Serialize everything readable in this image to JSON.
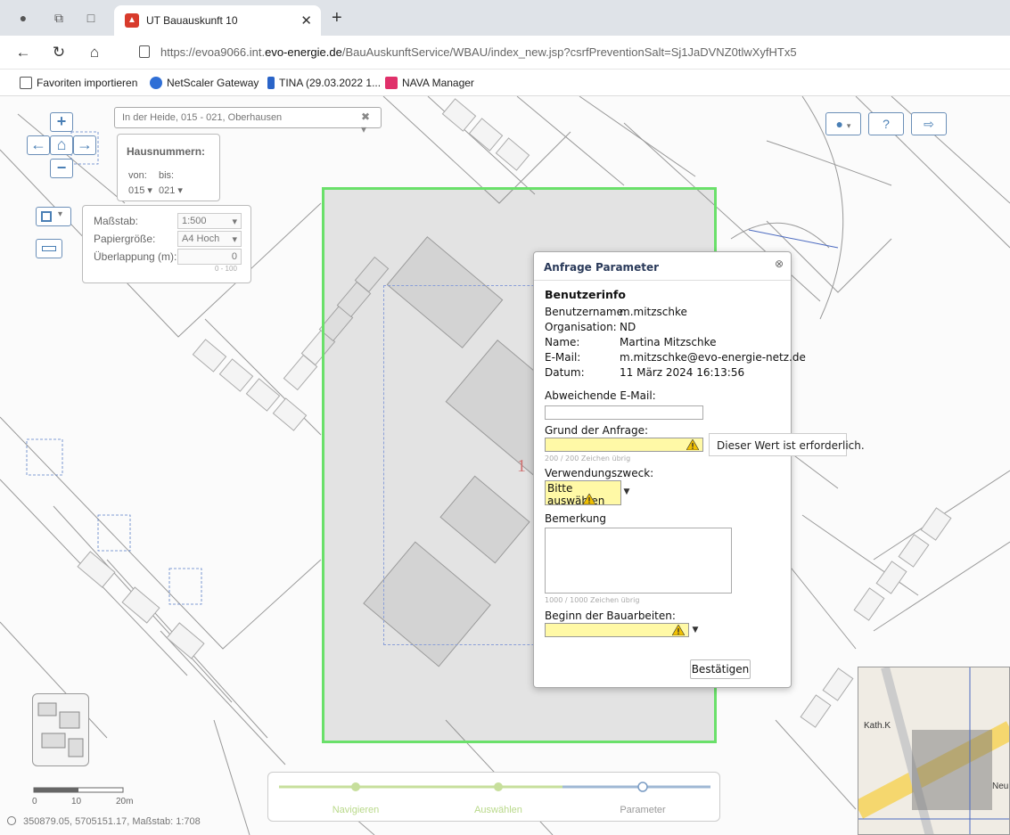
{
  "browser": {
    "tab_title": "UT Bauauskunft 10",
    "url_prefix": "https://evoa9066.int.",
    "url_host": "evo-energie.de",
    "url_path": "/BauAuskunftService/WBAU/index_new.jsp?csrfPreventionSalt=Sj1JaDVNZ0tlwXyfHTx5"
  },
  "favorites": [
    {
      "label": "Favoriten importieren"
    },
    {
      "label": "NetScaler Gateway"
    },
    {
      "label": "TINA (29.03.2022 1..."
    },
    {
      "label": "NAVA Manager"
    }
  ],
  "map": {
    "search_value": "In der Heide, 015 - 021,  Oberhausen",
    "housenumbers": {
      "title": "Hausnummern:",
      "from_label": "von:",
      "to_label": "bis:",
      "from_value": "015",
      "to_value": "021"
    },
    "print_panel": {
      "scale_label": "Maßstab:",
      "scale_value": "1:500",
      "paper_label": "Papiergröße:",
      "paper_value": "A4 Hoch",
      "overlap_label": "Überlappung (m):",
      "overlap_value": "0",
      "overlap_hint": "0 - 100"
    },
    "coords_text": "350879.05, 5705151.17, Maßstab: 1:708",
    "scale_labels": [
      "0",
      "10",
      "20m"
    ],
    "map_label_1": "1",
    "map_label_2": "Kath.K",
    "map_label_3": "Neu"
  },
  "dialog": {
    "title": "Anfrage Parameter",
    "section_user": "Benutzerinfo",
    "username_label": "Benutzername:",
    "username_value": "m.mitzschke",
    "org_label": "Organisation:",
    "org_value": "ND",
    "name_label": "Name:",
    "name_value": "Martina Mitzschke",
    "email_label": "E-Mail:",
    "email_value": "m.mitzschke@evo-energie-netz.de",
    "date_label": "Datum:",
    "date_value": "11 März 2024 16:13:56",
    "alt_email_label": "Abweichende E-Mail:",
    "reason_label": "Grund der Anfrage:",
    "reason_hint": "200 / 200 Zeichen übrig",
    "purpose_label": "Verwendungszweck:",
    "purpose_value": "Bitte auswählen",
    "remark_label": "Bemerkung",
    "remark_hint": "1000 / 1000 Zeichen übrig",
    "start_label": "Beginn der Bauarbeiten:",
    "confirm_label": "Bestätigen",
    "tooltip": "Dieser Wert ist erforderlich."
  },
  "steps": [
    {
      "label": "Navigieren",
      "state": "done"
    },
    {
      "label": "Auswählen",
      "state": "done"
    },
    {
      "label": "Parameter",
      "state": "active"
    }
  ],
  "colors": {
    "area_border": "#6ae06a",
    "required_bg": "#fff9a6",
    "accent": "#4a7fb5"
  }
}
